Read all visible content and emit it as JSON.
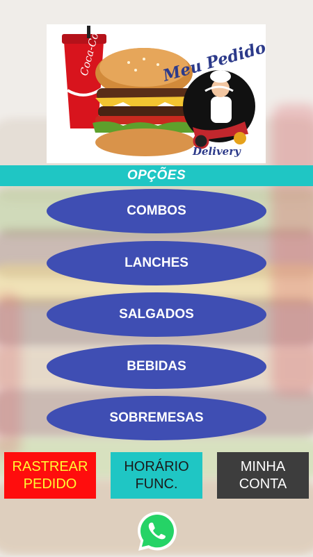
{
  "logo": {
    "brand_text": "Meu Pedido Já",
    "sub_text": "Delivery",
    "can_text": "Coca-Cola"
  },
  "options": {
    "title": "OPÇÕES",
    "items": [
      {
        "label": "COMBOS"
      },
      {
        "label": "LANCHES"
      },
      {
        "label": "SALGADOS"
      },
      {
        "label": "BEBIDAS"
      },
      {
        "label": "SOBREMESAS"
      }
    ]
  },
  "actions": {
    "track_order": "RASTREAR\nPEDIDO",
    "hours": "HORÁRIO\nFUNC.",
    "account": "MINHA\nCONTA"
  },
  "colors": {
    "accent_teal": "#1fc6c4",
    "menu_blue": "#3f4eb3",
    "track_red": "#ff0d0d",
    "track_text_yellow": "#fffa34",
    "account_dark": "#3d3d3d",
    "whatsapp_green": "#25d366"
  },
  "icons": {
    "whatsapp": "whatsapp-icon"
  }
}
